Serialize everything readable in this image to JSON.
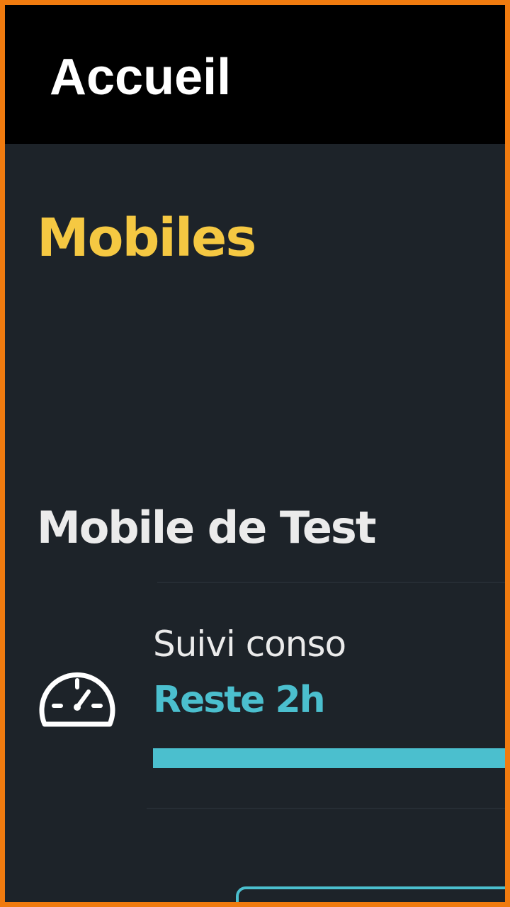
{
  "header": {
    "title": "Accueil"
  },
  "section": {
    "title": "Mobiles"
  },
  "device": {
    "name": "Mobile de Test",
    "usage": {
      "label": "Suivi conso",
      "remaining": "Reste 2h",
      "progress_fraction": 1.0,
      "icon": "speedometer-icon"
    }
  },
  "colors": {
    "border": "#f07b0f",
    "header_bg": "#000000",
    "page_bg": "#1d2329",
    "accent_yellow": "#f5c842",
    "accent_cyan": "#4bbfce",
    "text": "#ebebeb"
  }
}
